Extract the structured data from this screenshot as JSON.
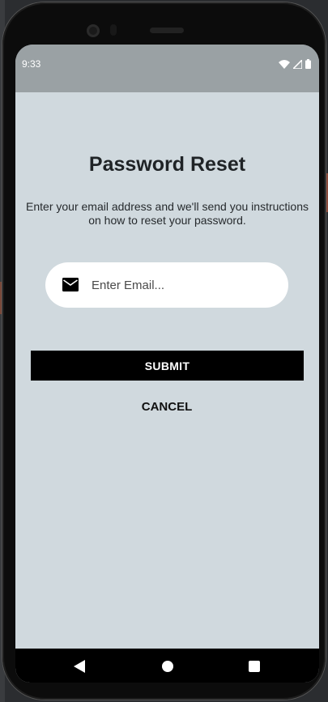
{
  "status_bar": {
    "time": "9:33",
    "icons": [
      "wifi-icon",
      "signal-icon",
      "battery-icon"
    ]
  },
  "page": {
    "title": "Password Reset",
    "subtitle": "Enter your email address and we'll send you instructions on how to reset your password."
  },
  "form": {
    "email_icon": "mail-icon",
    "email_placeholder": "Enter Email...",
    "email_value": "",
    "submit_label": "SUBMIT",
    "cancel_label": "CANCEL"
  },
  "nav_bar": {
    "buttons": [
      "back-icon",
      "home-icon",
      "recent-apps-icon"
    ]
  },
  "colors": {
    "screen_background": "#d0d9de",
    "status_bar": "#9aa1a4",
    "submit_button": "#000000",
    "input_background": "#ffffff"
  }
}
